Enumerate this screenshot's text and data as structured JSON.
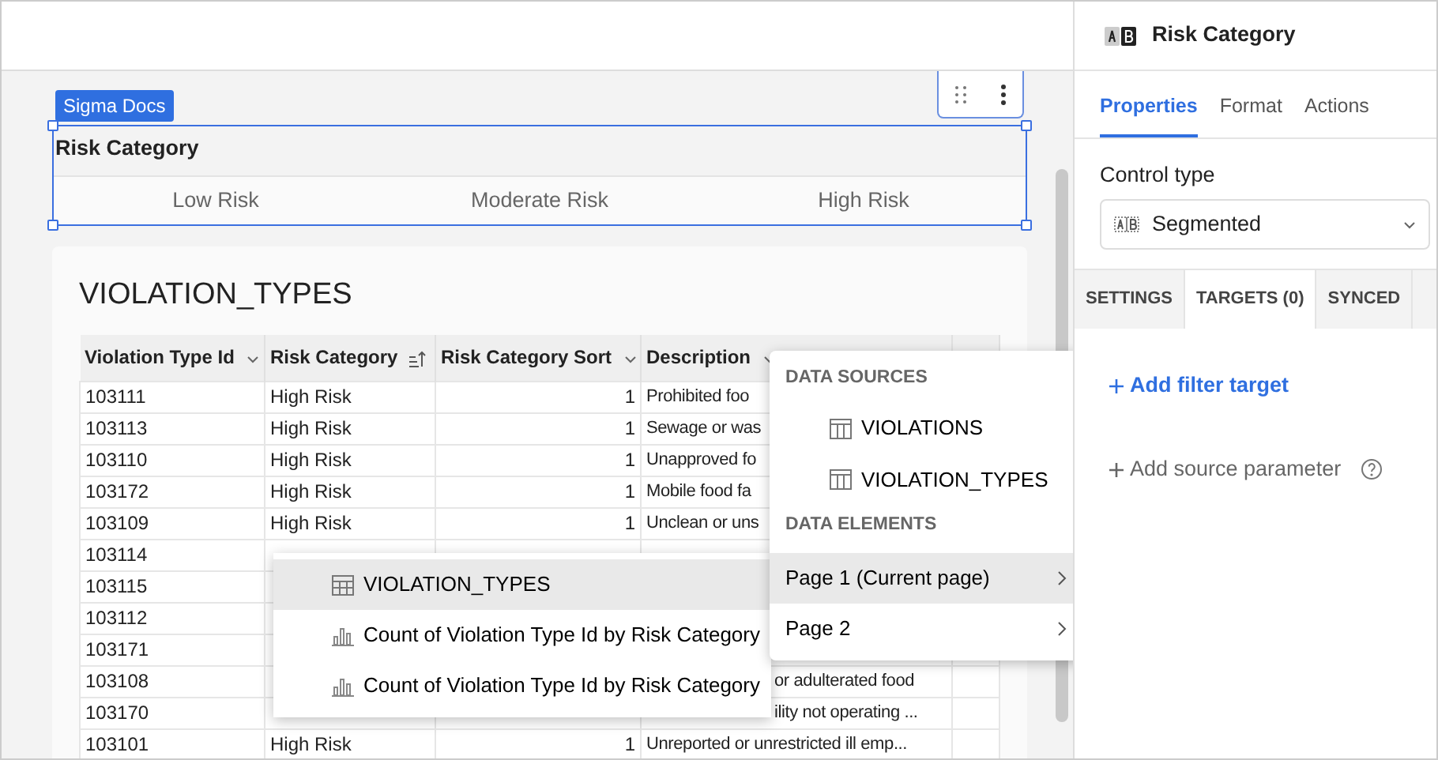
{
  "control_tag": "Sigma Docs",
  "control": {
    "title": "Risk Category",
    "segments": [
      {
        "label": "Low Risk",
        "selected": false
      },
      {
        "label": "Moderate Risk",
        "selected": false
      },
      {
        "label": "High Risk",
        "selected": false
      }
    ]
  },
  "table": {
    "title": "VIOLATION_TYPES",
    "columns": [
      {
        "label": "Violation Type Id",
        "kind": "menu"
      },
      {
        "label": "Risk Category",
        "kind": "sorted"
      },
      {
        "label": "Risk Category Sort",
        "kind": "menu"
      },
      {
        "label": "Description",
        "kind": "menu"
      }
    ],
    "rows": [
      {
        "kind": "full",
        "id": "103111",
        "risk_category": "High Risk",
        "sort": "1",
        "description": "Prohibited foo"
      },
      {
        "kind": "full",
        "id": "103113",
        "risk_category": "High Risk",
        "sort": "1",
        "description": "Sewage or was"
      },
      {
        "kind": "full",
        "id": "103110",
        "risk_category": "High Risk",
        "sort": "1",
        "description": "Unapproved fo"
      },
      {
        "kind": "full",
        "id": "103172",
        "risk_category": "High Risk",
        "sort": "1",
        "description": "Mobile food fa"
      },
      {
        "kind": "full",
        "id": "103109",
        "risk_category": "High Risk",
        "sort": "1",
        "description": "Unclean or uns"
      },
      {
        "kind": "covered",
        "id": "103114"
      },
      {
        "kind": "covered",
        "id": "103115"
      },
      {
        "kind": "covered",
        "id": "103112"
      },
      {
        "kind": "covered",
        "id": "103171"
      },
      {
        "kind": "covered",
        "id": "103108",
        "description": "or adulterated food"
      },
      {
        "kind": "covered",
        "id": "103170",
        "description": "ility not operating ..."
      },
      {
        "kind": "full",
        "id": "103101",
        "risk_category": "High Risk",
        "sort": "1",
        "description": "Unreported or unrestricted ill emp..."
      }
    ]
  },
  "sources_menu": {
    "sections": [
      {
        "heading": "DATA SOURCES",
        "items": [
          {
            "label": "VIOLATIONS",
            "kind": "source"
          },
          {
            "label": "VIOLATION_TYPES",
            "kind": "source"
          }
        ]
      },
      {
        "heading": "DATA ELEMENTS",
        "items": [
          {
            "label": "Page 1 (Current page)",
            "kind": "page",
            "selected": true
          },
          {
            "label": "Page 2",
            "kind": "page",
            "selected": false
          }
        ]
      }
    ]
  },
  "elements_menu": {
    "items": [
      {
        "label": "VIOLATION_TYPES",
        "kind": "table",
        "selected": true
      },
      {
        "label": "Count of Violation Type Id by Risk Category",
        "kind": "chart",
        "selected": false
      },
      {
        "label": "Count of Violation Type Id by Risk Category",
        "kind": "chart",
        "selected": false
      }
    ]
  },
  "panel": {
    "title": "Risk Category",
    "tabs": [
      {
        "label": "Properties",
        "selected": true
      },
      {
        "label": "Format",
        "selected": false
      },
      {
        "label": "Actions",
        "selected": false
      }
    ],
    "control_type_label": "Control type",
    "control_type": "Segmented",
    "subtabs": [
      {
        "label": "SETTINGS",
        "selected": false
      },
      {
        "label": "TARGETS (0)",
        "selected": true
      },
      {
        "label": "SYNCED",
        "selected": false
      }
    ],
    "actions": [
      {
        "label": "Add filter target",
        "kind": "primary"
      },
      {
        "label": "Add source parameter",
        "kind": "secondary"
      }
    ]
  }
}
